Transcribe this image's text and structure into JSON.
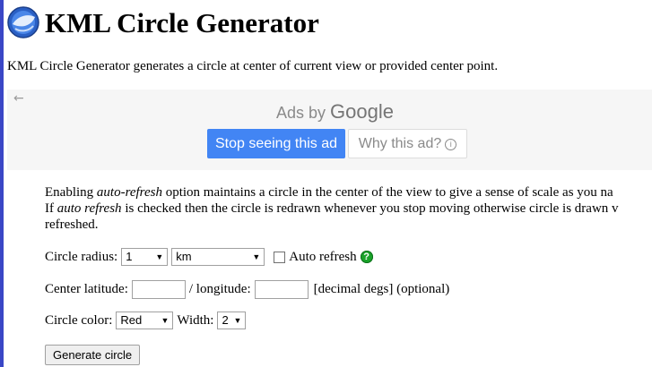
{
  "header": {
    "title": "KML Circle Generator",
    "logo_icon": "google-earth-globe-icon"
  },
  "intro_text": "KML Circle Generator generates a circle at center of current view or provided center point.",
  "ad": {
    "back_arrow": "←",
    "ads_by": "Ads by",
    "google": "Google",
    "stop_label": "Stop seeing this ad",
    "why_label": "Why this ad?",
    "info_glyph": "i"
  },
  "description": {
    "p1_a": "Enabling ",
    "p1_em": "auto-refresh",
    "p1_b": " option maintains a circle in the center of the view to give a sense of scale as you na",
    "p2_a": "If ",
    "p2_em": "auto refresh",
    "p2_b": " is checked then the circle is redrawn whenever you stop moving otherwise circle is drawn v",
    "p3": "refreshed."
  },
  "form": {
    "radius_label": "Circle radius:",
    "radius_value": "1",
    "unit_value": "km",
    "auto_refresh_label": "Auto refresh",
    "auto_refresh_checked": false,
    "help_glyph": "?",
    "center_lat_label": "Center latitude:",
    "lat_value": "",
    "lon_label": "/ longitude:",
    "lon_value": "",
    "coord_hint": "[decimal degs] (optional)",
    "color_label": "Circle color:",
    "color_value": "Red",
    "width_label": "Width:",
    "width_value": "2",
    "generate_label": "Generate circle"
  },
  "colors": {
    "accent_stripe": "#3a47c6",
    "ad_button": "#4285f4",
    "help_icon": "#1aa32a"
  }
}
